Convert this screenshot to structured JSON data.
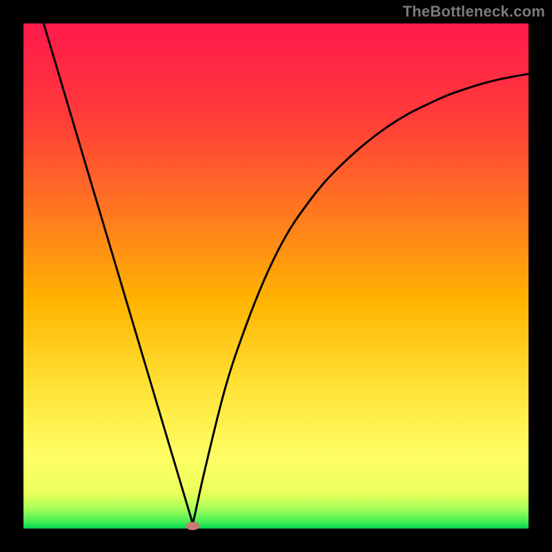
{
  "attribution": "TheBottleneck.com",
  "chart_data": {
    "type": "line",
    "title": "",
    "xlabel": "",
    "ylabel": "",
    "xlim": [
      0,
      100
    ],
    "ylim": [
      0,
      100
    ],
    "grid": false,
    "legend": false,
    "background_gradient": {
      "top_color": "#ff1a4b",
      "mid_colors": [
        "#ff5c2e",
        "#ffa500",
        "#ffe236",
        "#ffff66"
      ],
      "bottom_color": "#00d64f"
    },
    "series": [
      {
        "name": "bottleneck-curve",
        "color": "#000000",
        "x": [
          4,
          8,
          12,
          16,
          20,
          24,
          28,
          30,
          32,
          33,
          33.5,
          34,
          36,
          40,
          44,
          48,
          52,
          56,
          60,
          64,
          68,
          72,
          76,
          80,
          84,
          88,
          92,
          96,
          100
        ],
        "y": [
          100,
          87,
          74,
          61,
          48,
          35,
          22,
          15,
          8,
          4,
          1,
          3,
          12,
          28,
          40,
          50,
          58,
          64,
          69,
          73,
          76.5,
          79.5,
          82,
          84,
          85.8,
          87.2,
          88.4,
          89.3,
          90
        ]
      }
    ],
    "marker": {
      "name": "optimal-point",
      "x": 33.5,
      "y": 0.5,
      "color": "#c77c6f",
      "rx": 1.4,
      "ry": 0.8
    }
  }
}
